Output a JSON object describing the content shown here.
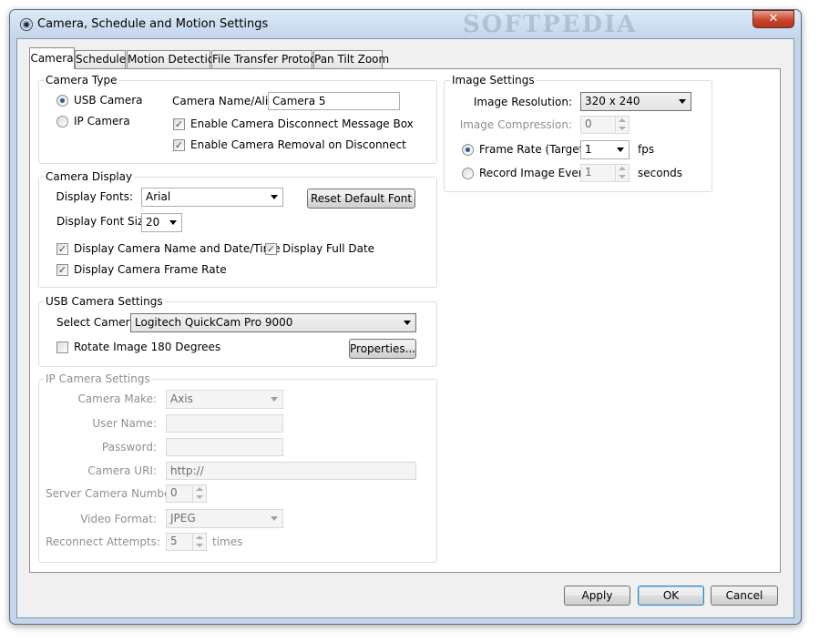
{
  "window": {
    "title": "Camera, Schedule and Motion Settings",
    "watermark": "SOFTPEDIA",
    "close_glyph": "✕",
    "icon": "webcam-icon"
  },
  "tabs": [
    {
      "label": "Camera",
      "active": true
    },
    {
      "label": "Schedule",
      "active": false
    },
    {
      "label": "Motion Detection",
      "active": false
    },
    {
      "label": "File Transfer Protocol",
      "active": false
    },
    {
      "label": "Pan Tilt Zoom",
      "active": false
    }
  ],
  "camera_type": {
    "legend": "Camera Type",
    "usb_label": "USB Camera",
    "ip_label": "IP Camera",
    "selected": "USB Camera",
    "name_label": "Camera Name/Alias:",
    "name_value": "Camera 5",
    "disconnect_msg_label": "Enable Camera Disconnect Message Box",
    "removal_label": "Enable Camera Removal on Disconnect",
    "check_glyph": "✓"
  },
  "camera_display": {
    "legend": "Camera Display",
    "fonts_label": "Display Fonts:",
    "fonts_value": "Arial",
    "reset_font_label": "Reset Default Font",
    "font_size_label": "Display Font Size:",
    "font_size_value": "20",
    "show_name_date_label": "Display Camera Name and Date/Time",
    "full_date_label": "Display Full Date",
    "frame_rate_label": "Display Camera Frame Rate"
  },
  "usb_settings": {
    "legend": "USB Camera Settings",
    "select_label": "Select Camera:",
    "select_value": "Logitech QuickCam Pro 9000",
    "rotate_label": "Rotate Image 180 Degrees",
    "properties_label": "Properties..."
  },
  "ip_settings": {
    "legend": "IP Camera Settings",
    "make_label": "Camera Make:",
    "make_value": "Axis",
    "user_label": "User Name:",
    "user_value": "",
    "password_label": "Password:",
    "password_value": "",
    "uri_label": "Camera URI:",
    "uri_value": "http://",
    "server_num_label": "Server Camera Number:",
    "server_num_value": "0",
    "video_format_label": "Video Format:",
    "video_format_value": "JPEG",
    "reconnect_label": "Reconnect Attempts:",
    "reconnect_value": "5",
    "reconnect_unit": "times"
  },
  "image_settings": {
    "legend": "Image Settings",
    "resolution_label": "Image Resolution:",
    "resolution_value": "320 x 240",
    "compression_label": "Image Compression:",
    "compression_value": "0",
    "frame_rate_label": "Frame Rate (Target):",
    "frame_rate_value": "1",
    "frame_rate_unit": "fps",
    "record_label": "Record Image Every:",
    "record_value": "1",
    "record_unit": "seconds",
    "selected": "Frame Rate (Target):"
  },
  "footer": {
    "apply_label": "Apply",
    "ok_label": "OK",
    "cancel_label": "Cancel"
  }
}
